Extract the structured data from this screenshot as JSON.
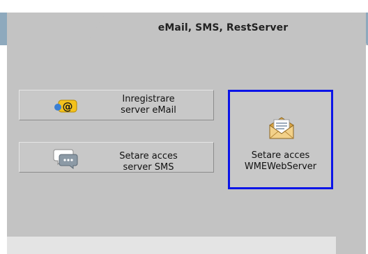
{
  "tab": {
    "label": "eMail, SMS, RestServer"
  },
  "buttons": [
    {
      "line1": "Inregistrare",
      "line2": "server eMail",
      "icon": "email-at-icon"
    },
    {
      "line1": "Setare acces",
      "line2": "server SMS",
      "icon": "chat-bubble-icon"
    }
  ],
  "selected_button": {
    "line1": "Setare acces",
    "line2": "WMEWebServer",
    "icon": "envelope-icon"
  },
  "colors": {
    "accent_border": "#0b14e8",
    "tab_strip": "#8ea9bd",
    "panel": "#c3c3c3"
  }
}
